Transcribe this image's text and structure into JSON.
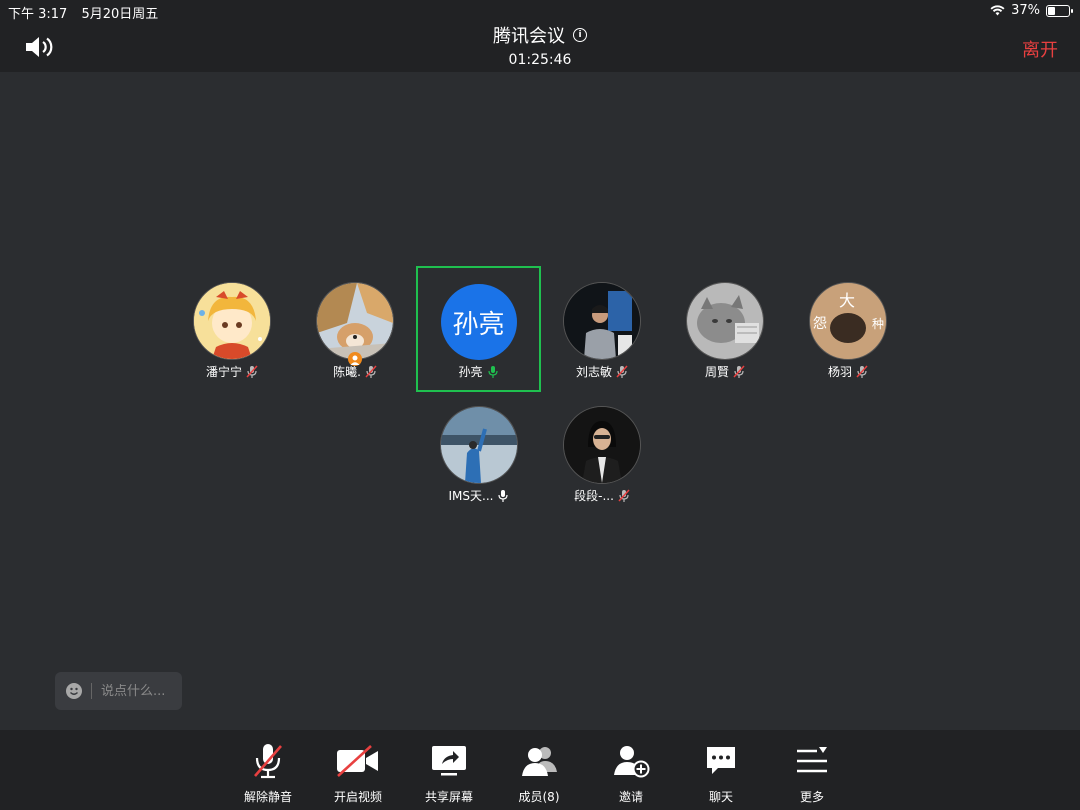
{
  "status": {
    "time": "下午 3:17",
    "date": "5月20日周五",
    "battery": "37%",
    "battery_level": 0.37
  },
  "header": {
    "title": "腾讯会议",
    "timer": "01:25:46",
    "leave_label": "离开"
  },
  "participants": [
    {
      "name": "潘宁宁",
      "mic": "muted"
    },
    {
      "name": "陈曦.",
      "mic": "muted"
    },
    {
      "name": "孙亮",
      "mic": "speaking",
      "avatar_text": "孙亮"
    },
    {
      "name": "刘志敏",
      "mic": "muted"
    },
    {
      "name": "周賢",
      "mic": "muted"
    },
    {
      "name": "杨羽",
      "mic": "muted",
      "avatar_chars": [
        "大",
        "怨",
        "种"
      ]
    },
    {
      "name": "IMS天...",
      "mic": "on"
    },
    {
      "name": "段段-...",
      "mic": "muted"
    }
  ],
  "chat": {
    "placeholder": "说点什么..."
  },
  "toolbar": {
    "unmute": "解除静音",
    "video": "开启视频",
    "share": "共享屏幕",
    "members": "成员(8)",
    "invite": "邀请",
    "chat": "聊天",
    "more": "更多"
  },
  "colors": {
    "accent_leave": "#e84040",
    "speaking_border": "#1fc04f",
    "avatar_blue": "#1a73e8",
    "mute_red": "#e84040"
  }
}
